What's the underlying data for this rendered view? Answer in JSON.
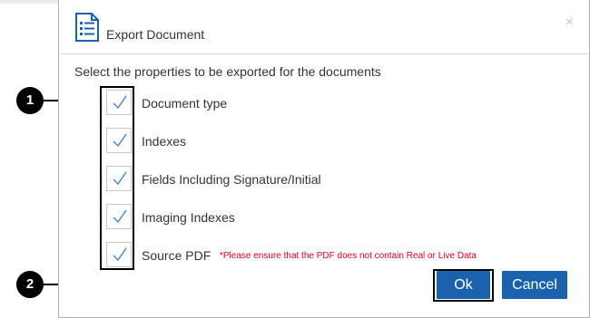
{
  "dialog": {
    "title": "Export Document",
    "close_symbol": "×",
    "instruction": "Select the properties to be exported for the documents",
    "icon": "document-list-icon"
  },
  "options": [
    {
      "label": "Document type",
      "checked": true
    },
    {
      "label": "Indexes",
      "checked": true
    },
    {
      "label": "Fields Including Signature/Initial",
      "checked": true
    },
    {
      "label": "Imaging Indexes",
      "checked": true
    },
    {
      "label": "Source PDF",
      "checked": true
    }
  ],
  "warning": "*Please ensure that the PDF does not contain Real or Live Data",
  "buttons": {
    "ok": "Ok",
    "cancel": "Cancel"
  },
  "callouts": {
    "one": "1",
    "two": "2"
  },
  "colors": {
    "primary": "#1a63ac",
    "check": "#3a7bd5",
    "warning": "#e0001a"
  }
}
